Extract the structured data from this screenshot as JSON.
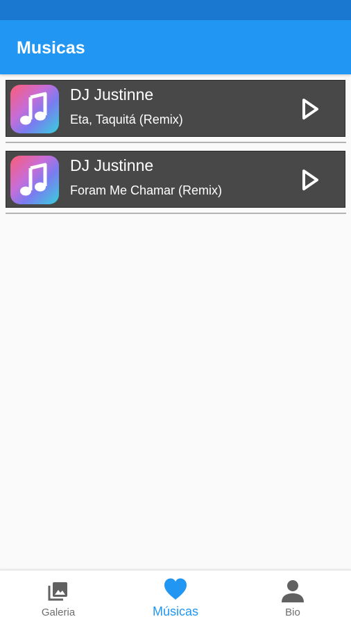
{
  "app": {
    "title": "Musicas"
  },
  "colors": {
    "status_bar": "#1b78d0",
    "app_bar": "#2196f3",
    "card_background": "#484848",
    "active_nav": "#2196f3",
    "inactive_nav": "#6e6e6e"
  },
  "tracks": [
    {
      "artist": "DJ Justinne",
      "title": "Eta, Taquitá (Remix)",
      "art_icon": "music-note-icon",
      "action_icon": "play-icon"
    },
    {
      "artist": "DJ Justinne",
      "title": "Foram Me Chamar (Remix)",
      "art_icon": "music-note-icon",
      "action_icon": "play-icon"
    }
  ],
  "bottom_nav": {
    "items": [
      {
        "label": "Galeria",
        "icon": "photo-library-icon",
        "active": false
      },
      {
        "label": "Músicas",
        "icon": "heart-icon",
        "active": true
      },
      {
        "label": "Bio",
        "icon": "person-icon",
        "active": false
      }
    ]
  }
}
